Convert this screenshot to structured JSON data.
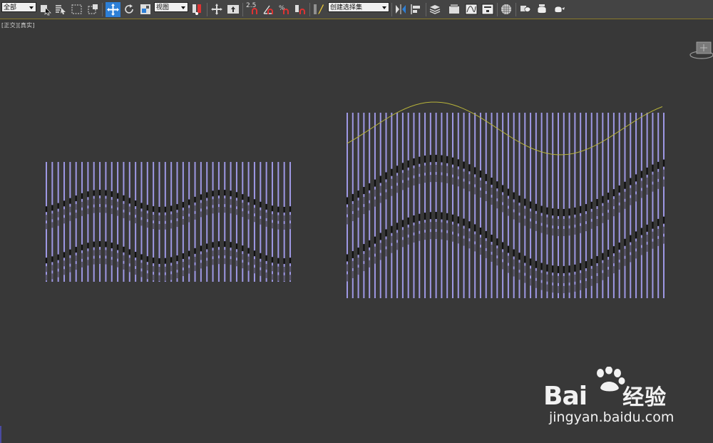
{
  "toolbar": {
    "selection_filter": "全部",
    "reference_coord": "视图",
    "snap_angle": "2.5",
    "named_selection": "创建选择集"
  },
  "viewport": {
    "label": "[正交][真实]"
  },
  "colors": {
    "background": "#383838",
    "toolbar": "#444444",
    "slat": "#9e98e4",
    "wave_dark": "#111111",
    "curve": "#b6b23a",
    "accent_blue": "#2d7fd6"
  },
  "watermark": {
    "brand": "Bai",
    "brand_cn": "经验",
    "url": "jingyan.baidu.com"
  }
}
